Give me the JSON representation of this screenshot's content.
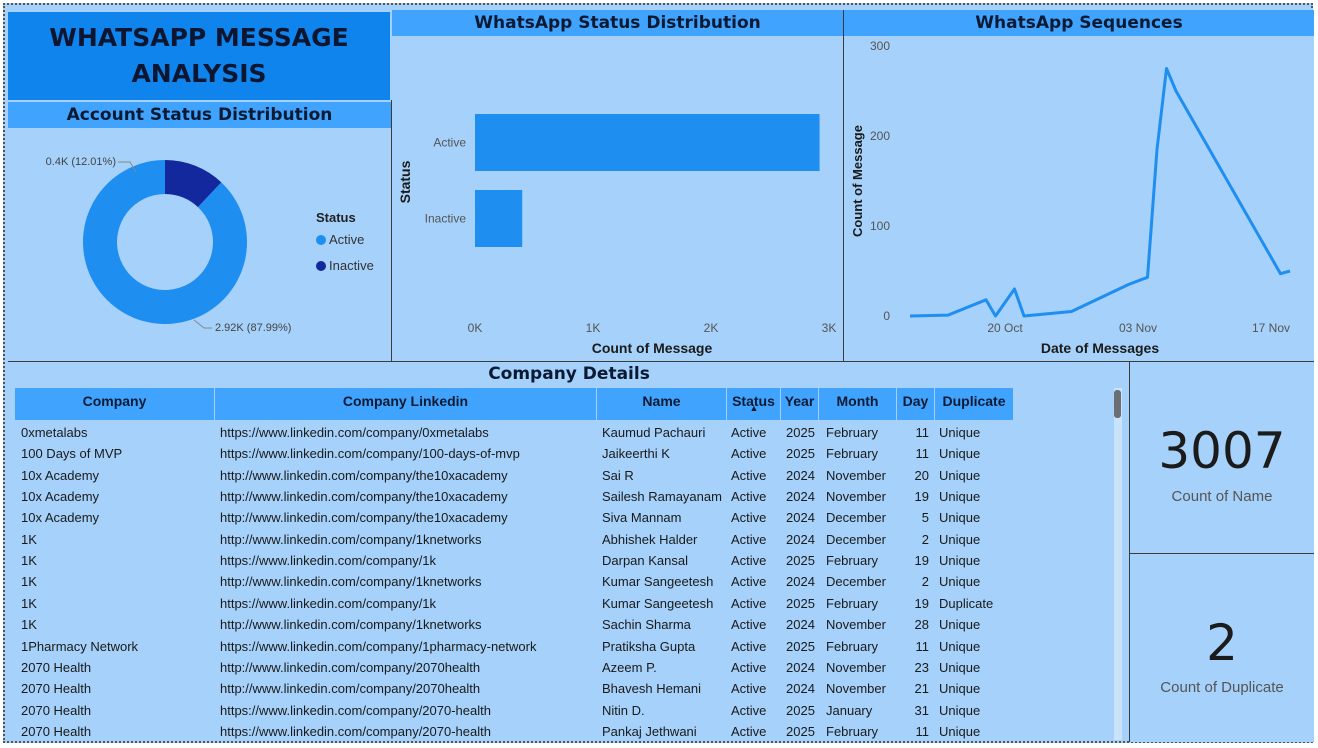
{
  "report_title": [
    "WHATSAPP MESSAGE",
    "ANALYSIS"
  ],
  "colors": {
    "accent": "#40a4ff",
    "active": "#1f8ef1",
    "inactive": "#13289c",
    "title_bg": "#0f84ec",
    "bg": "#a5d1fa"
  },
  "account_status": {
    "title": "Account Status Distribution",
    "legend_title": "Status",
    "legend": [
      "Active",
      "Inactive"
    ],
    "label_inactive": "0.4K (12.01%)",
    "label_active": "2.92K (87.99%)"
  },
  "status_distribution": {
    "title": "WhatsApp Status Distribution",
    "ylabel": "Status",
    "xlabel": "Count of Message",
    "xticks": [
      "0K",
      "1K",
      "2K",
      "3K"
    ]
  },
  "sequences": {
    "title": "WhatsApp Sequences",
    "ylabel": "Count of Message",
    "xlabel": "Date of Messages",
    "yticks": [
      "0",
      "100",
      "200",
      "300"
    ],
    "xticks": [
      "20 Oct",
      "03 Nov",
      "17 Nov"
    ]
  },
  "chart_data": [
    {
      "type": "pie",
      "title": "Account Status Distribution",
      "categories": [
        "Active",
        "Inactive"
      ],
      "values": [
        2920,
        400
      ],
      "percent": [
        87.99,
        12.01
      ]
    },
    {
      "type": "bar",
      "title": "WhatsApp Status Distribution",
      "orientation": "horizontal",
      "categories": [
        "Active",
        "Inactive"
      ],
      "values": [
        2920,
        400
      ],
      "xlim": [
        0,
        3000
      ],
      "xlabel": "Count of Message",
      "ylabel": "Status"
    },
    {
      "type": "line",
      "title": "WhatsApp Sequences",
      "x": [
        "2024-10-10",
        "2024-10-14",
        "2024-10-18",
        "2024-10-19",
        "2024-10-21",
        "2024-10-22",
        "2024-10-27",
        "2024-11-02",
        "2024-11-04",
        "2024-11-05",
        "2024-11-06",
        "2024-11-07",
        "2024-11-18",
        "2024-11-19"
      ],
      "y": [
        0,
        1,
        18,
        0,
        30,
        0,
        5,
        35,
        43,
        185,
        275,
        250,
        47,
        50
      ],
      "ylim": [
        0,
        300
      ],
      "xlabel": "Date of Messages",
      "ylabel": "Count of Message"
    }
  ],
  "table": {
    "title": "Company Details",
    "columns": [
      "Company",
      "Company Linkedin",
      "Name",
      "Status",
      "Year",
      "Month",
      "Day",
      "Duplicate"
    ],
    "sort_indicator": "▲",
    "rows": [
      [
        "0xmetalabs",
        "https://www.linkedin.com/company/0xmetalabs",
        "Kaumud Pachauri",
        "Active",
        "2025",
        "February",
        "11",
        "Unique"
      ],
      [
        "100 Days of MVP",
        "https://www.linkedin.com/company/100-days-of-mvp",
        "Jaikeerthi K",
        "Active",
        "2025",
        "February",
        "11",
        "Unique"
      ],
      [
        "10x Academy",
        "http://www.linkedin.com/company/the10xacademy",
        "Sai R",
        "Active",
        "2024",
        "November",
        "20",
        "Unique"
      ],
      [
        "10x Academy",
        "http://www.linkedin.com/company/the10xacademy",
        "Sailesh Ramayanam",
        "Active",
        "2024",
        "November",
        "19",
        "Unique"
      ],
      [
        "10x Academy",
        "http://www.linkedin.com/company/the10xacademy",
        "Siva Mannam",
        "Active",
        "2024",
        "December",
        "5",
        "Unique"
      ],
      [
        "1K",
        "http://www.linkedin.com/company/1knetworks",
        "Abhishek Halder",
        "Active",
        "2024",
        "December",
        "2",
        "Unique"
      ],
      [
        "1K",
        "https://www.linkedin.com/company/1k",
        "Darpan Kansal",
        "Active",
        "2025",
        "February",
        "19",
        "Unique"
      ],
      [
        "1K",
        "http://www.linkedin.com/company/1knetworks",
        "Kumar Sangeetesh",
        "Active",
        "2024",
        "December",
        "2",
        "Unique"
      ],
      [
        "1K",
        "https://www.linkedin.com/company/1k",
        "Kumar Sangeetesh",
        "Active",
        "2025",
        "February",
        "19",
        "Duplicate"
      ],
      [
        "1K",
        "http://www.linkedin.com/company/1knetworks",
        "Sachin Sharma",
        "Active",
        "2024",
        "November",
        "28",
        "Unique"
      ],
      [
        "1Pharmacy Network",
        "https://www.linkedin.com/company/1pharmacy-network",
        "Pratiksha Gupta",
        "Active",
        "2025",
        "February",
        "11",
        "Unique"
      ],
      [
        "2070 Health",
        "http://www.linkedin.com/company/2070health",
        "Azeem P.",
        "Active",
        "2024",
        "November",
        "23",
        "Unique"
      ],
      [
        "2070 Health",
        "http://www.linkedin.com/company/2070health",
        "Bhavesh Hemani",
        "Active",
        "2024",
        "November",
        "21",
        "Unique"
      ],
      [
        "2070 Health",
        "https://www.linkedin.com/company/2070-health",
        "Nitin D.",
        "Active",
        "2025",
        "January",
        "31",
        "Unique"
      ],
      [
        "2070 Health",
        "https://www.linkedin.com/company/2070-health",
        "Pankaj Jethwani",
        "Active",
        "2025",
        "February",
        "11",
        "Unique"
      ]
    ]
  },
  "kpis": [
    {
      "value": "3007",
      "label": "Count of Name"
    },
    {
      "value": "2",
      "label": "Count of Duplicate"
    }
  ]
}
